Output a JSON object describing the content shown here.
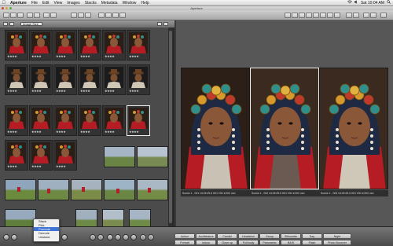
{
  "menubar": {
    "apple": "",
    "items": [
      "Aperture",
      "File",
      "Edit",
      "View",
      "Images",
      "Stacks",
      "Metadata",
      "Window",
      "Help"
    ],
    "clock": "Sat 10:04 AM"
  },
  "window": {
    "title": "Aperture"
  },
  "browser": {
    "popup_value": "Image Size"
  },
  "popup_menu": {
    "items": [
      "Stack",
      "Pick",
      "Promote",
      "Demote",
      "Unstack"
    ]
  },
  "viewer": {
    "captions": [
      "Scene 1 - 001  1/125 f/5.6 ISO 200  1/200 mm",
      "Scene 1 - 002  1/125 f/5.6 ISO 200  1/200 mm",
      "Scene 1 - 003  1/125 f/5.6 ISO 200  1/200 mm"
    ]
  },
  "keywords": {
    "row1": [
      "Action",
      "Architecture",
      "Candid",
      "Headshot",
      "Group",
      "Silhouette",
      "Day",
      "Night"
    ],
    "row2": [
      "Portrait",
      "Indoor",
      "Close up",
      "Full body",
      "Panoramic",
      "B&W",
      "Flash",
      "Photo Bouncer"
    ]
  }
}
